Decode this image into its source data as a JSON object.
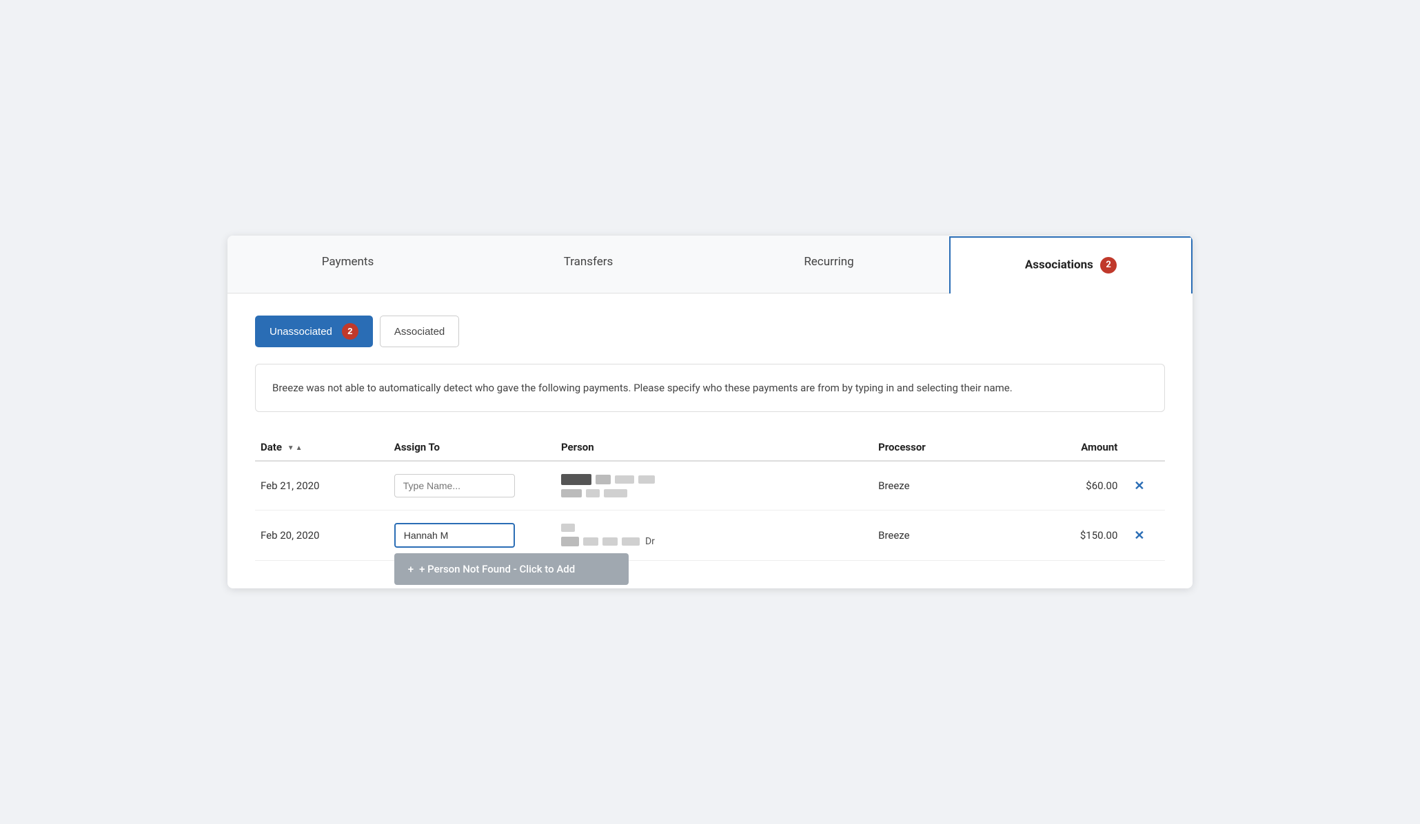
{
  "tabs": [
    {
      "id": "payments",
      "label": "Payments",
      "active": false,
      "badge": null
    },
    {
      "id": "transfers",
      "label": "Transfers",
      "active": false,
      "badge": null
    },
    {
      "id": "recurring",
      "label": "Recurring",
      "active": false,
      "badge": null
    },
    {
      "id": "associations",
      "label": "Associations",
      "active": true,
      "badge": "2"
    }
  ],
  "subtabs": [
    {
      "id": "unassociated",
      "label": "Unassociated",
      "active": true,
      "badge": "2"
    },
    {
      "id": "associated",
      "label": "Associated",
      "active": false,
      "badge": null
    }
  ],
  "info_message": "Breeze was not able to automatically detect who gave the following payments. Please specify who these payments are from by typing in and selecting their name.",
  "table": {
    "columns": [
      "Date",
      "Assign To",
      "Person",
      "Processor",
      "Amount"
    ],
    "rows": [
      {
        "date": "Feb 21, 2020",
        "assign_to_placeholder": "Type Name...",
        "assign_to_value": "",
        "processor": "Breeze",
        "amount": "$60.00"
      },
      {
        "date": "Feb 20, 2020",
        "assign_to_placeholder": "Type Name...",
        "assign_to_value": "Hannah M",
        "processor": "Breeze",
        "amount": "$150.00"
      }
    ]
  },
  "dropdown": {
    "label": "+ Person Not Found - Click to Add"
  },
  "icons": {
    "sort_up": "▲",
    "sort_down": "▼",
    "close": "✕",
    "plus": "+"
  },
  "colors": {
    "active_tab_border": "#2a6db5",
    "badge_bg": "#c0392b",
    "active_subtab_bg": "#2a6db5",
    "dropdown_bg": "#a0a8b0"
  }
}
